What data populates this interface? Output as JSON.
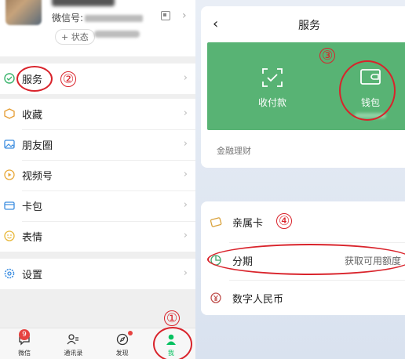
{
  "left": {
    "profile": {
      "wechat_id_label": "微信号:",
      "status_label": "+ 状态"
    },
    "menu": [
      {
        "label": "服务",
        "icon": "service-icon"
      },
      {
        "label": "收藏",
        "icon": "favorites-icon"
      },
      {
        "label": "朋友圈",
        "icon": "moments-icon"
      },
      {
        "label": "视频号",
        "icon": "channels-icon"
      },
      {
        "label": "卡包",
        "icon": "card-wallet-icon"
      },
      {
        "label": "表情",
        "icon": "sticker-icon"
      },
      {
        "label": "设置",
        "icon": "settings-icon"
      }
    ],
    "tabbar": [
      {
        "label": "微信",
        "badge": "9"
      },
      {
        "label": "通讯录"
      },
      {
        "label": "发现"
      },
      {
        "label": "我"
      }
    ],
    "annotations": {
      "n1": "①",
      "n2": "②"
    }
  },
  "right": {
    "title": "服务",
    "green_items": [
      {
        "label": "收付款",
        "icon": "scan-pay-icon"
      },
      {
        "label": "钱包",
        "icon": "wallet-icon"
      }
    ],
    "finance_label": "金融理财",
    "items": [
      {
        "label": "亲属卡",
        "icon": "family-card-icon"
      },
      {
        "label": "分期",
        "note": "获取可用额度",
        "icon": "installment-icon"
      },
      {
        "label": "数字人民币",
        "icon": "digital-rmb-icon"
      }
    ],
    "annotations": {
      "n3": "③",
      "n4": "④"
    }
  },
  "colors": {
    "accent_green": "#58b374",
    "annotation_red": "#d9232b",
    "brand_green": "#07c160"
  }
}
